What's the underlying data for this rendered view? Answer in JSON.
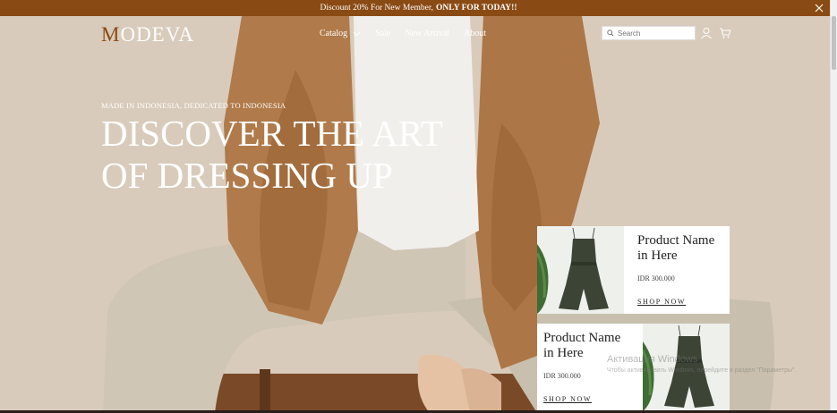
{
  "announcement": {
    "text": "Discount 20% For New Member,",
    "bold": "ONLY FOR TODAY!!",
    "bg_color": "#8a4a14"
  },
  "header": {
    "logo_first": "M",
    "logo_rest": "ODEVA",
    "nav": [
      {
        "label": "Catalog",
        "has_dropdown": true
      },
      {
        "label": "Sale"
      },
      {
        "label": "New Arrival"
      },
      {
        "label": "About"
      }
    ],
    "search_placeholder": "Search",
    "icons": [
      "search-icon",
      "user-icon",
      "cart-icon"
    ]
  },
  "hero": {
    "tagline": "MADE IN INDONESIA, DEDICATED TO INDONESIA",
    "headline": "DISCOVER THE ART OF DRESSING UP"
  },
  "products": [
    {
      "name": "Product Name in Here",
      "price": "IDR 300.000",
      "cta": "SHOP NOW"
    },
    {
      "name": "Product Name in Here",
      "price": "IDR 300.000",
      "cta": "SHOP NOW"
    }
  ],
  "os_watermark": {
    "line1": "Активация Windows",
    "line2": "Чтобы активировать Windows, перейдите в раздел \"Параметры\"."
  }
}
